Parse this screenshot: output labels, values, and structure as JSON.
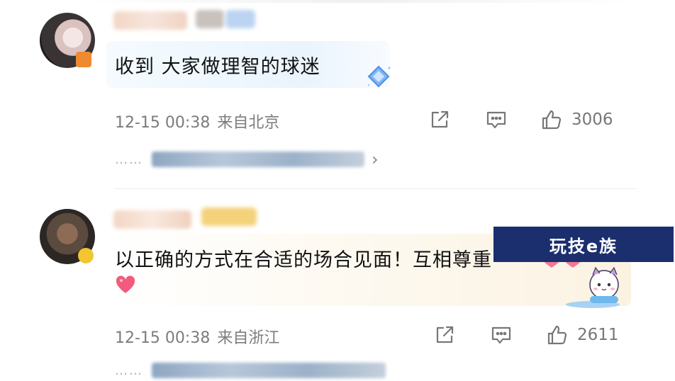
{
  "comments": [
    {
      "text": "收到 大家做理智的球迷",
      "time": "12-15 00:38",
      "location": "来自北京",
      "likes": "3006"
    },
    {
      "text": "以正确的方式在合适的场合见面！互相尊重",
      "time": "12-15 00:38",
      "location": "来自浙江",
      "likes": "2611"
    }
  ],
  "reply_prefix": "……",
  "watermark": "玩技e族",
  "colors": {
    "meta_text": "#7c7c7c",
    "reply_link": "#6f8aa6",
    "watermark_bg": "#1b2e6e"
  },
  "icons": [
    "share-icon",
    "comment-icon",
    "like-icon",
    "chevron-right-icon",
    "diamond-icon",
    "heart-icon"
  ]
}
